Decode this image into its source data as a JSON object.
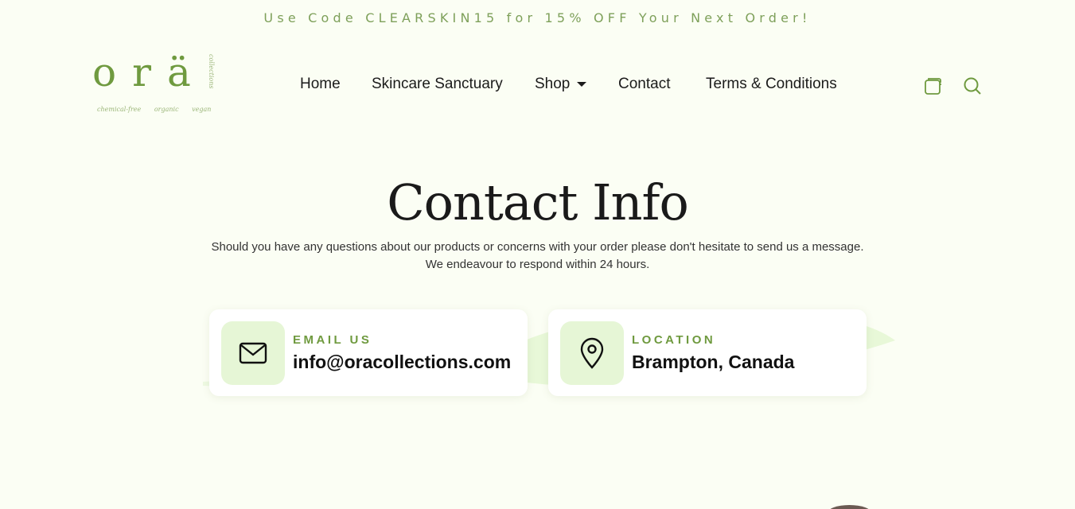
{
  "promo": {
    "text": "Use Code CLEARSKIN15 for 15% OFF Your Next Order!"
  },
  "logo": {
    "wordmark": "orä",
    "vertical_text": "collections",
    "tagline": "chemical-free organic vegan"
  },
  "nav": {
    "items": [
      {
        "label": "Home"
      },
      {
        "label": "Skincare Sanctuary"
      },
      {
        "label": "Shop"
      },
      {
        "label": "Contact"
      },
      {
        "label": "Terms & Conditions"
      }
    ]
  },
  "header_icons": {
    "cart": "cart-icon",
    "search": "search-icon"
  },
  "main": {
    "title": "Contact Info",
    "intro_line1": "Should you have any questions about our products or concerns with your order please don't hesitate to send us a message.",
    "intro_line2": "We endeavour to respond within 24 hours.",
    "cards": [
      {
        "label": "EMAIL US",
        "value": "info@oracollections.com",
        "icon": "mail-icon"
      },
      {
        "label": "LOCATION",
        "value": "Brampton, Canada",
        "icon": "map-pin-icon"
      }
    ]
  },
  "colors": {
    "accent": "#6f9a3f",
    "background": "#fbfef4",
    "icon_bg": "#e6f6d6"
  }
}
